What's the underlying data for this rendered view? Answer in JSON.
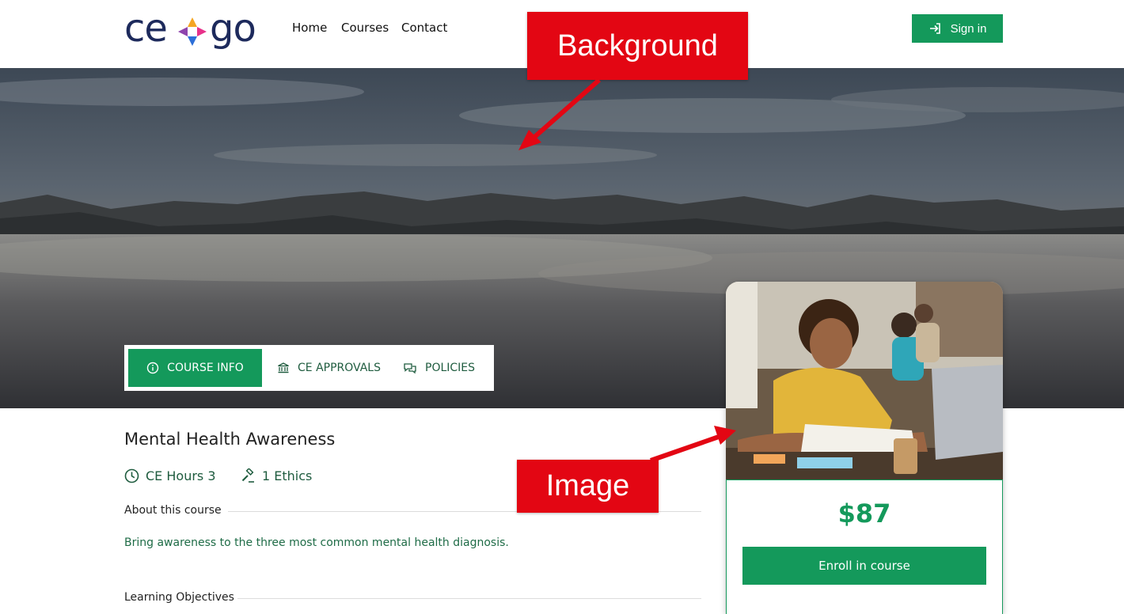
{
  "header": {
    "logo_left": "ce",
    "logo_right": "go",
    "nav": [
      "Home",
      "Courses",
      "Contact"
    ],
    "signin_label": "Sign in"
  },
  "tabs": [
    {
      "label": "COURSE INFO",
      "icon": "info-icon"
    },
    {
      "label": "CE APPROVALS",
      "icon": "bank-icon"
    },
    {
      "label": "POLICIES",
      "icon": "chat-icon"
    }
  ],
  "course": {
    "title": "Mental Health Awareness",
    "hours_label": "CE Hours 3",
    "ethics_label": "1 Ethics",
    "about_heading": "About this course",
    "description": "Bring awareness to the three most common mental health diagnosis.",
    "objectives_heading": "Learning Objectives"
  },
  "card": {
    "price": "$87",
    "enroll_label": "Enroll in course"
  },
  "annotations": {
    "background": "Background",
    "image": "Image"
  },
  "colors": {
    "brand_green": "#14995b",
    "navy": "#1d2a5c",
    "annotation_red": "#e30613"
  }
}
